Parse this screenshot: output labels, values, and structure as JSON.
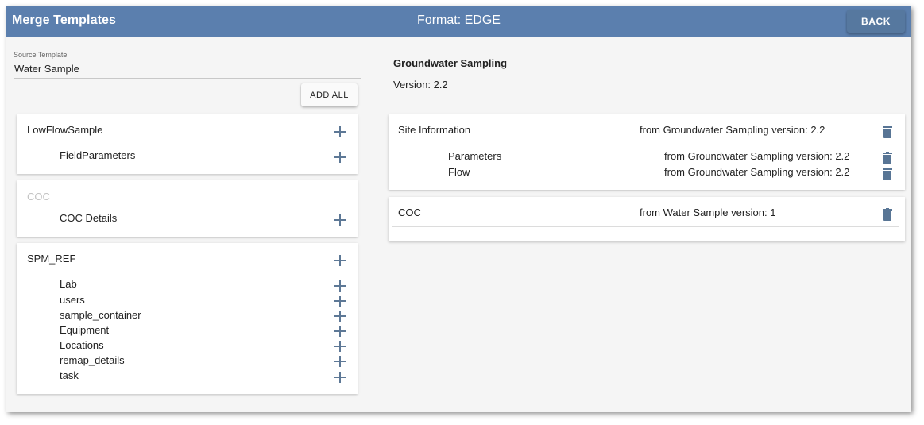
{
  "header": {
    "title": "Merge Templates",
    "format": "Format: EDGE",
    "back_label": "BACK"
  },
  "source": {
    "label": "Source Template",
    "value": "Water Sample",
    "add_all_label": "ADD ALL"
  },
  "source_groups": [
    {
      "title": "LowFlowSample",
      "disabled": false,
      "items": [
        "FieldParameters"
      ]
    },
    {
      "title": "COC",
      "disabled": true,
      "items": [
        "COC Details"
      ]
    },
    {
      "title": "SPM_REF",
      "disabled": false,
      "items": [
        "Lab",
        "users",
        "sample_container",
        "Equipment",
        "Locations",
        "remap_details",
        "task"
      ]
    }
  ],
  "target": {
    "title": "Groundwater Sampling",
    "version": "Version: 2.2",
    "groups": [
      {
        "label": "Site Information",
        "from": "from Groundwater Sampling version: 2.2",
        "children": [
          {
            "label": "Parameters",
            "from": "from Groundwater Sampling version: 2.2"
          },
          {
            "label": "Flow",
            "from": "from Groundwater Sampling version: 2.2"
          }
        ]
      },
      {
        "label": "COC",
        "from": "from Water Sample version: 1",
        "children": []
      }
    ]
  },
  "colors": {
    "header_bg": "#5b7fae",
    "icon": "#587595",
    "disabled_text": "#c4c4c4"
  },
  "icons": {
    "add": "plus-icon",
    "delete": "trash-icon"
  }
}
